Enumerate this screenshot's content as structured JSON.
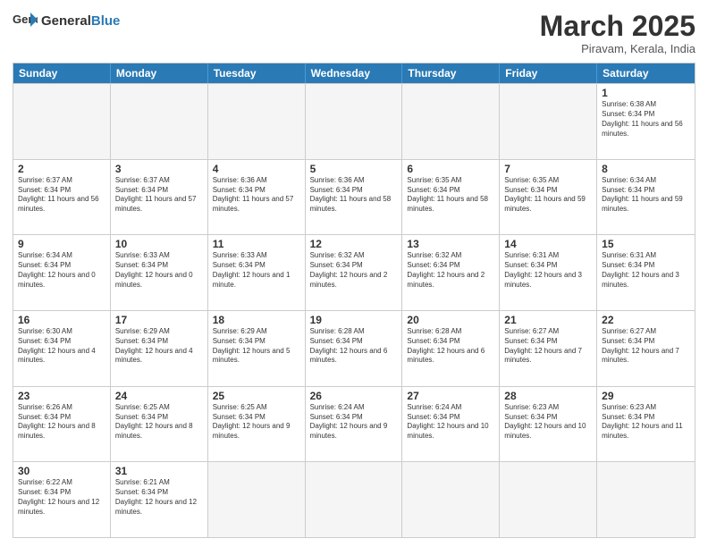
{
  "header": {
    "logo_general": "General",
    "logo_blue": "Blue",
    "month_title": "March 2025",
    "location": "Piravam, Kerala, India"
  },
  "days": [
    "Sunday",
    "Monday",
    "Tuesday",
    "Wednesday",
    "Thursday",
    "Friday",
    "Saturday"
  ],
  "weeks": [
    [
      {
        "day": "",
        "empty": true
      },
      {
        "day": "",
        "empty": true
      },
      {
        "day": "",
        "empty": true
      },
      {
        "day": "",
        "empty": true
      },
      {
        "day": "",
        "empty": true
      },
      {
        "day": "",
        "empty": true
      },
      {
        "day": "1",
        "sunrise": "6:38 AM",
        "sunset": "6:34 PM",
        "daylight": "11 hours and 56 minutes."
      }
    ],
    [
      {
        "day": "2",
        "sunrise": "6:37 AM",
        "sunset": "6:34 PM",
        "daylight": "11 hours and 56 minutes."
      },
      {
        "day": "3",
        "sunrise": "6:37 AM",
        "sunset": "6:34 PM",
        "daylight": "11 hours and 57 minutes."
      },
      {
        "day": "4",
        "sunrise": "6:36 AM",
        "sunset": "6:34 PM",
        "daylight": "11 hours and 57 minutes."
      },
      {
        "day": "5",
        "sunrise": "6:36 AM",
        "sunset": "6:34 PM",
        "daylight": "11 hours and 58 minutes."
      },
      {
        "day": "6",
        "sunrise": "6:35 AM",
        "sunset": "6:34 PM",
        "daylight": "11 hours and 58 minutes."
      },
      {
        "day": "7",
        "sunrise": "6:35 AM",
        "sunset": "6:34 PM",
        "daylight": "11 hours and 59 minutes."
      },
      {
        "day": "8",
        "sunrise": "6:34 AM",
        "sunset": "6:34 PM",
        "daylight": "11 hours and 59 minutes."
      }
    ],
    [
      {
        "day": "9",
        "sunrise": "6:34 AM",
        "sunset": "6:34 PM",
        "daylight": "12 hours and 0 minutes."
      },
      {
        "day": "10",
        "sunrise": "6:33 AM",
        "sunset": "6:34 PM",
        "daylight": "12 hours and 0 minutes."
      },
      {
        "day": "11",
        "sunrise": "6:33 AM",
        "sunset": "6:34 PM",
        "daylight": "12 hours and 1 minute."
      },
      {
        "day": "12",
        "sunrise": "6:32 AM",
        "sunset": "6:34 PM",
        "daylight": "12 hours and 2 minutes."
      },
      {
        "day": "13",
        "sunrise": "6:32 AM",
        "sunset": "6:34 PM",
        "daylight": "12 hours and 2 minutes."
      },
      {
        "day": "14",
        "sunrise": "6:31 AM",
        "sunset": "6:34 PM",
        "daylight": "12 hours and 3 minutes."
      },
      {
        "day": "15",
        "sunrise": "6:31 AM",
        "sunset": "6:34 PM",
        "daylight": "12 hours and 3 minutes."
      }
    ],
    [
      {
        "day": "16",
        "sunrise": "6:30 AM",
        "sunset": "6:34 PM",
        "daylight": "12 hours and 4 minutes."
      },
      {
        "day": "17",
        "sunrise": "6:29 AM",
        "sunset": "6:34 PM",
        "daylight": "12 hours and 4 minutes."
      },
      {
        "day": "18",
        "sunrise": "6:29 AM",
        "sunset": "6:34 PM",
        "daylight": "12 hours and 5 minutes."
      },
      {
        "day": "19",
        "sunrise": "6:28 AM",
        "sunset": "6:34 PM",
        "daylight": "12 hours and 6 minutes."
      },
      {
        "day": "20",
        "sunrise": "6:28 AM",
        "sunset": "6:34 PM",
        "daylight": "12 hours and 6 minutes."
      },
      {
        "day": "21",
        "sunrise": "6:27 AM",
        "sunset": "6:34 PM",
        "daylight": "12 hours and 7 minutes."
      },
      {
        "day": "22",
        "sunrise": "6:27 AM",
        "sunset": "6:34 PM",
        "daylight": "12 hours and 7 minutes."
      }
    ],
    [
      {
        "day": "23",
        "sunrise": "6:26 AM",
        "sunset": "6:34 PM",
        "daylight": "12 hours and 8 minutes."
      },
      {
        "day": "24",
        "sunrise": "6:25 AM",
        "sunset": "6:34 PM",
        "daylight": "12 hours and 8 minutes."
      },
      {
        "day": "25",
        "sunrise": "6:25 AM",
        "sunset": "6:34 PM",
        "daylight": "12 hours and 9 minutes."
      },
      {
        "day": "26",
        "sunrise": "6:24 AM",
        "sunset": "6:34 PM",
        "daylight": "12 hours and 9 minutes."
      },
      {
        "day": "27",
        "sunrise": "6:24 AM",
        "sunset": "6:34 PM",
        "daylight": "12 hours and 10 minutes."
      },
      {
        "day": "28",
        "sunrise": "6:23 AM",
        "sunset": "6:34 PM",
        "daylight": "12 hours and 10 minutes."
      },
      {
        "day": "29",
        "sunrise": "6:23 AM",
        "sunset": "6:34 PM",
        "daylight": "12 hours and 11 minutes."
      }
    ],
    [
      {
        "day": "30",
        "sunrise": "6:22 AM",
        "sunset": "6:34 PM",
        "daylight": "12 hours and 12 minutes."
      },
      {
        "day": "31",
        "sunrise": "6:21 AM",
        "sunset": "6:34 PM",
        "daylight": "12 hours and 12 minutes."
      },
      {
        "day": "",
        "empty": true
      },
      {
        "day": "",
        "empty": true
      },
      {
        "day": "",
        "empty": true
      },
      {
        "day": "",
        "empty": true
      },
      {
        "day": "",
        "empty": true
      }
    ]
  ]
}
